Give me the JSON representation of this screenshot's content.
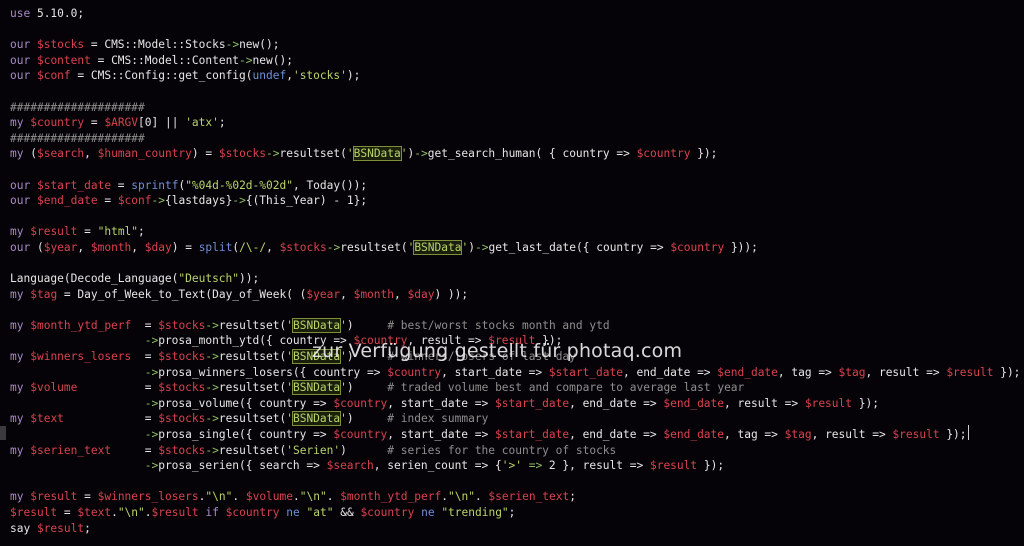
{
  "editor": {
    "theme": {
      "background": "#050307",
      "keyword": "#a78bc9",
      "variable": "#d9424f",
      "string": "#b9d46a",
      "function": "#6f8fd8",
      "comment": "#8e8e8e",
      "arrow": "#8fbf6a",
      "plain": "#e6e6e6"
    },
    "lines": [
      [
        [
          "kw",
          "use"
        ],
        [
          "plain",
          " 5.10.0;"
        ]
      ],
      [],
      [
        [
          "kw",
          "our"
        ],
        [
          "plain",
          " "
        ],
        [
          "var",
          "$stocks"
        ],
        [
          "plain",
          " = CMS::Model::Stocks"
        ],
        [
          "arrow",
          "->"
        ],
        [
          "plain",
          "new();"
        ]
      ],
      [
        [
          "kw",
          "our"
        ],
        [
          "plain",
          " "
        ],
        [
          "var",
          "$content"
        ],
        [
          "plain",
          " = CMS::Model::Content"
        ],
        [
          "arrow",
          "->"
        ],
        [
          "plain",
          "new();"
        ]
      ],
      [
        [
          "kw",
          "our"
        ],
        [
          "plain",
          " "
        ],
        [
          "var",
          "$conf"
        ],
        [
          "plain",
          " = CMS::Config::get_config("
        ],
        [
          "fn",
          "undef"
        ],
        [
          "plain",
          ","
        ],
        [
          "str",
          "'stocks'"
        ],
        [
          "plain",
          ");"
        ]
      ],
      [],
      [
        [
          "cmt",
          "####################"
        ]
      ],
      [
        [
          "kw",
          "my"
        ],
        [
          "plain",
          " "
        ],
        [
          "var",
          "$country"
        ],
        [
          "plain",
          " = "
        ],
        [
          "var",
          "$ARGV"
        ],
        [
          "plain",
          "[0] || "
        ],
        [
          "str",
          "'atx'"
        ],
        [
          "plain",
          ";"
        ]
      ],
      [
        [
          "cmt",
          "####################"
        ]
      ],
      [
        [
          "kw",
          "my"
        ],
        [
          "plain",
          " ("
        ],
        [
          "var",
          "$search"
        ],
        [
          "plain",
          ", "
        ],
        [
          "var",
          "$human_country"
        ],
        [
          "plain",
          ") = "
        ],
        [
          "var",
          "$stocks"
        ],
        [
          "arrow",
          "->"
        ],
        [
          "plain",
          "resultset("
        ],
        [
          "str",
          "'"
        ],
        [
          "hl",
          "BSNData"
        ],
        [
          "str",
          "'"
        ],
        [
          "plain",
          ")"
        ],
        [
          "arrow",
          "->"
        ],
        [
          "plain",
          "get_search_human( { country => "
        ],
        [
          "var",
          "$country"
        ],
        [
          "plain",
          " });"
        ]
      ],
      [],
      [
        [
          "kw",
          "our"
        ],
        [
          "plain",
          " "
        ],
        [
          "var",
          "$start_date"
        ],
        [
          "plain",
          " = "
        ],
        [
          "fn",
          "sprintf"
        ],
        [
          "plain",
          "("
        ],
        [
          "str",
          "\"%04d-%02d-%02d\""
        ],
        [
          "plain",
          ", Today());"
        ]
      ],
      [
        [
          "kw",
          "our"
        ],
        [
          "plain",
          " "
        ],
        [
          "var",
          "$end_date"
        ],
        [
          "plain",
          " = "
        ],
        [
          "var",
          "$conf"
        ],
        [
          "arrow",
          "->"
        ],
        [
          "plain",
          "{lastdays}"
        ],
        [
          "arrow",
          "->"
        ],
        [
          "plain",
          "{(This_Year) - 1};"
        ]
      ],
      [],
      [
        [
          "kw",
          "my"
        ],
        [
          "plain",
          " "
        ],
        [
          "var",
          "$result"
        ],
        [
          "plain",
          " = "
        ],
        [
          "str",
          "\"html\""
        ],
        [
          "plain",
          ";"
        ]
      ],
      [
        [
          "kw",
          "our"
        ],
        [
          "plain",
          " ("
        ],
        [
          "var",
          "$year"
        ],
        [
          "plain",
          ", "
        ],
        [
          "var",
          "$month"
        ],
        [
          "plain",
          ", "
        ],
        [
          "var",
          "$day"
        ],
        [
          "plain",
          ") = "
        ],
        [
          "fn",
          "split"
        ],
        [
          "plain",
          "("
        ],
        [
          "str",
          "/\\-/"
        ],
        [
          "plain",
          ", "
        ],
        [
          "var",
          "$stocks"
        ],
        [
          "arrow",
          "->"
        ],
        [
          "plain",
          "resultset("
        ],
        [
          "str",
          "'"
        ],
        [
          "hl",
          "BSNData"
        ],
        [
          "str",
          "'"
        ],
        [
          "plain",
          ")"
        ],
        [
          "arrow",
          "->"
        ],
        [
          "plain",
          "get_last_date({ country => "
        ],
        [
          "var",
          "$country"
        ],
        [
          "plain",
          " }));"
        ]
      ],
      [],
      [
        [
          "plain",
          "Language(Decode_Language("
        ],
        [
          "str",
          "\"Deutsch\""
        ],
        [
          "plain",
          "));"
        ]
      ],
      [
        [
          "kw",
          "my"
        ],
        [
          "plain",
          " "
        ],
        [
          "var",
          "$tag"
        ],
        [
          "plain",
          " = Day_of_Week_to_Text(Day_of_Week( ("
        ],
        [
          "var",
          "$year"
        ],
        [
          "plain",
          ", "
        ],
        [
          "var",
          "$month"
        ],
        [
          "plain",
          ", "
        ],
        [
          "var",
          "$day"
        ],
        [
          "plain",
          ") ));"
        ]
      ],
      [],
      [
        [
          "kw",
          "my"
        ],
        [
          "plain",
          " "
        ],
        [
          "var",
          "$month_ytd_perf"
        ],
        [
          "plain",
          "  = "
        ],
        [
          "var",
          "$stocks"
        ],
        [
          "arrow",
          "->"
        ],
        [
          "plain",
          "resultset("
        ],
        [
          "str",
          "'"
        ],
        [
          "hl",
          "BSNData"
        ],
        [
          "str",
          "'"
        ],
        [
          "plain",
          ")     "
        ],
        [
          "cmt",
          "# best/worst stocks month and ytd"
        ]
      ],
      [
        [
          "plain",
          "                    "
        ],
        [
          "arrow",
          "->"
        ],
        [
          "plain",
          "prosa_month_ytd({ country => "
        ],
        [
          "var",
          "$country"
        ],
        [
          "plain",
          ", result => "
        ],
        [
          "var",
          "$result"
        ],
        [
          "plain",
          " });"
        ]
      ],
      [
        [
          "kw",
          "my"
        ],
        [
          "plain",
          " "
        ],
        [
          "var",
          "$winners_losers"
        ],
        [
          "plain",
          "  = "
        ],
        [
          "var",
          "$stocks"
        ],
        [
          "arrow",
          "->"
        ],
        [
          "plain",
          "resultset("
        ],
        [
          "str",
          "'"
        ],
        [
          "hl",
          "BSNData"
        ],
        [
          "str",
          "'"
        ],
        [
          "plain",
          ")     "
        ],
        [
          "cmt",
          "# winners/losers of last day"
        ]
      ],
      [
        [
          "plain",
          "                    "
        ],
        [
          "arrow",
          "->"
        ],
        [
          "plain",
          "prosa_winners_losers({ country => "
        ],
        [
          "var",
          "$country"
        ],
        [
          "plain",
          ", start_date => "
        ],
        [
          "var",
          "$start_date"
        ],
        [
          "plain",
          ", end_date => "
        ],
        [
          "var",
          "$end_date"
        ],
        [
          "plain",
          ", tag => "
        ],
        [
          "var",
          "$tag"
        ],
        [
          "plain",
          ", result => "
        ],
        [
          "var",
          "$result"
        ],
        [
          "plain",
          " });"
        ]
      ],
      [
        [
          "kw",
          "my"
        ],
        [
          "plain",
          " "
        ],
        [
          "var",
          "$volume"
        ],
        [
          "plain",
          "          = "
        ],
        [
          "var",
          "$stocks"
        ],
        [
          "arrow",
          "->"
        ],
        [
          "plain",
          "resultset("
        ],
        [
          "str",
          "'"
        ],
        [
          "hl",
          "BSNData"
        ],
        [
          "str",
          "'"
        ],
        [
          "plain",
          ")     "
        ],
        [
          "cmt",
          "# traded volume best and compare to average last year"
        ]
      ],
      [
        [
          "plain",
          "                    "
        ],
        [
          "arrow",
          "->"
        ],
        [
          "plain",
          "prosa_volume({ country => "
        ],
        [
          "var",
          "$country"
        ],
        [
          "plain",
          ", start_date => "
        ],
        [
          "var",
          "$start_date"
        ],
        [
          "plain",
          ", end_date => "
        ],
        [
          "var",
          "$end_date"
        ],
        [
          "plain",
          ", result => "
        ],
        [
          "var",
          "$result"
        ],
        [
          "plain",
          " });"
        ]
      ],
      [
        [
          "kw",
          "my"
        ],
        [
          "plain",
          " "
        ],
        [
          "var",
          "$text"
        ],
        [
          "plain",
          "            = "
        ],
        [
          "var",
          "$stocks"
        ],
        [
          "arrow",
          "->"
        ],
        [
          "plain",
          "resultset("
        ],
        [
          "str",
          "'"
        ],
        [
          "hl",
          "BSNData"
        ],
        [
          "str",
          "'"
        ],
        [
          "plain",
          ")     "
        ],
        [
          "cmt",
          "# index summary"
        ]
      ],
      [
        [
          "plain",
          "                    "
        ],
        [
          "arrow",
          "->"
        ],
        [
          "plain",
          "prosa_single({ country => "
        ],
        [
          "var",
          "$country"
        ],
        [
          "plain",
          ", start_date => "
        ],
        [
          "var",
          "$start_date"
        ],
        [
          "plain",
          ", end_date => "
        ],
        [
          "var",
          "$end_date"
        ],
        [
          "plain",
          ", tag => "
        ],
        [
          "var",
          "$tag"
        ],
        [
          "plain",
          ", result => "
        ],
        [
          "var",
          "$result"
        ],
        [
          "plain",
          " });"
        ]
      ],
      [
        [
          "kw",
          "my"
        ],
        [
          "plain",
          " "
        ],
        [
          "var",
          "$serien_text"
        ],
        [
          "plain",
          "     = "
        ],
        [
          "var",
          "$stocks"
        ],
        [
          "arrow",
          "->"
        ],
        [
          "plain",
          "resultset("
        ],
        [
          "str",
          "'Serien'"
        ],
        [
          "plain",
          ")      "
        ],
        [
          "cmt",
          "# series for the country of stocks"
        ]
      ],
      [
        [
          "plain",
          "                    "
        ],
        [
          "arrow",
          "->"
        ],
        [
          "plain",
          "prosa_serien({ search => "
        ],
        [
          "var",
          "$search"
        ],
        [
          "plain",
          ", serien_count => {"
        ],
        [
          "str",
          "'>'"
        ],
        [
          "plain",
          " "
        ],
        [
          "arrow",
          "=>"
        ],
        [
          "plain",
          " 2 }, result => "
        ],
        [
          "var",
          "$result"
        ],
        [
          "plain",
          " });"
        ]
      ],
      [],
      [
        [
          "kw",
          "my"
        ],
        [
          "plain",
          " "
        ],
        [
          "var",
          "$result"
        ],
        [
          "plain",
          " = "
        ],
        [
          "var",
          "$winners_losers"
        ],
        [
          "plain",
          "."
        ],
        [
          "str",
          "\"\\n\""
        ],
        [
          "plain",
          ". "
        ],
        [
          "var",
          "$volume"
        ],
        [
          "plain",
          "."
        ],
        [
          "str",
          "\"\\n\""
        ],
        [
          "plain",
          ". "
        ],
        [
          "var",
          "$month_ytd_perf"
        ],
        [
          "plain",
          "."
        ],
        [
          "str",
          "\"\\n\""
        ],
        [
          "plain",
          ". "
        ],
        [
          "var",
          "$serien_text"
        ],
        [
          "plain",
          ";"
        ]
      ],
      [
        [
          "var",
          "$result"
        ],
        [
          "plain",
          " = "
        ],
        [
          "var",
          "$text"
        ],
        [
          "plain",
          "."
        ],
        [
          "str",
          "\"\\n\""
        ],
        [
          "plain",
          "."
        ],
        [
          "var",
          "$result"
        ],
        [
          "plain",
          " "
        ],
        [
          "kw",
          "if"
        ],
        [
          "plain",
          " "
        ],
        [
          "var",
          "$country"
        ],
        [
          "plain",
          " "
        ],
        [
          "fn",
          "ne"
        ],
        [
          "plain",
          " "
        ],
        [
          "str",
          "\"at\""
        ],
        [
          "plain",
          " && "
        ],
        [
          "var",
          "$country"
        ],
        [
          "plain",
          " "
        ],
        [
          "fn",
          "ne"
        ],
        [
          "plain",
          " "
        ],
        [
          "str",
          "\"trending\""
        ],
        [
          "plain",
          ";"
        ]
      ],
      [
        [
          "plain",
          "say "
        ],
        [
          "var",
          "$result"
        ],
        [
          "plain",
          ";"
        ]
      ]
    ]
  },
  "watermark": {
    "text": "zur Verfügung gestellt für photaq.com"
  }
}
